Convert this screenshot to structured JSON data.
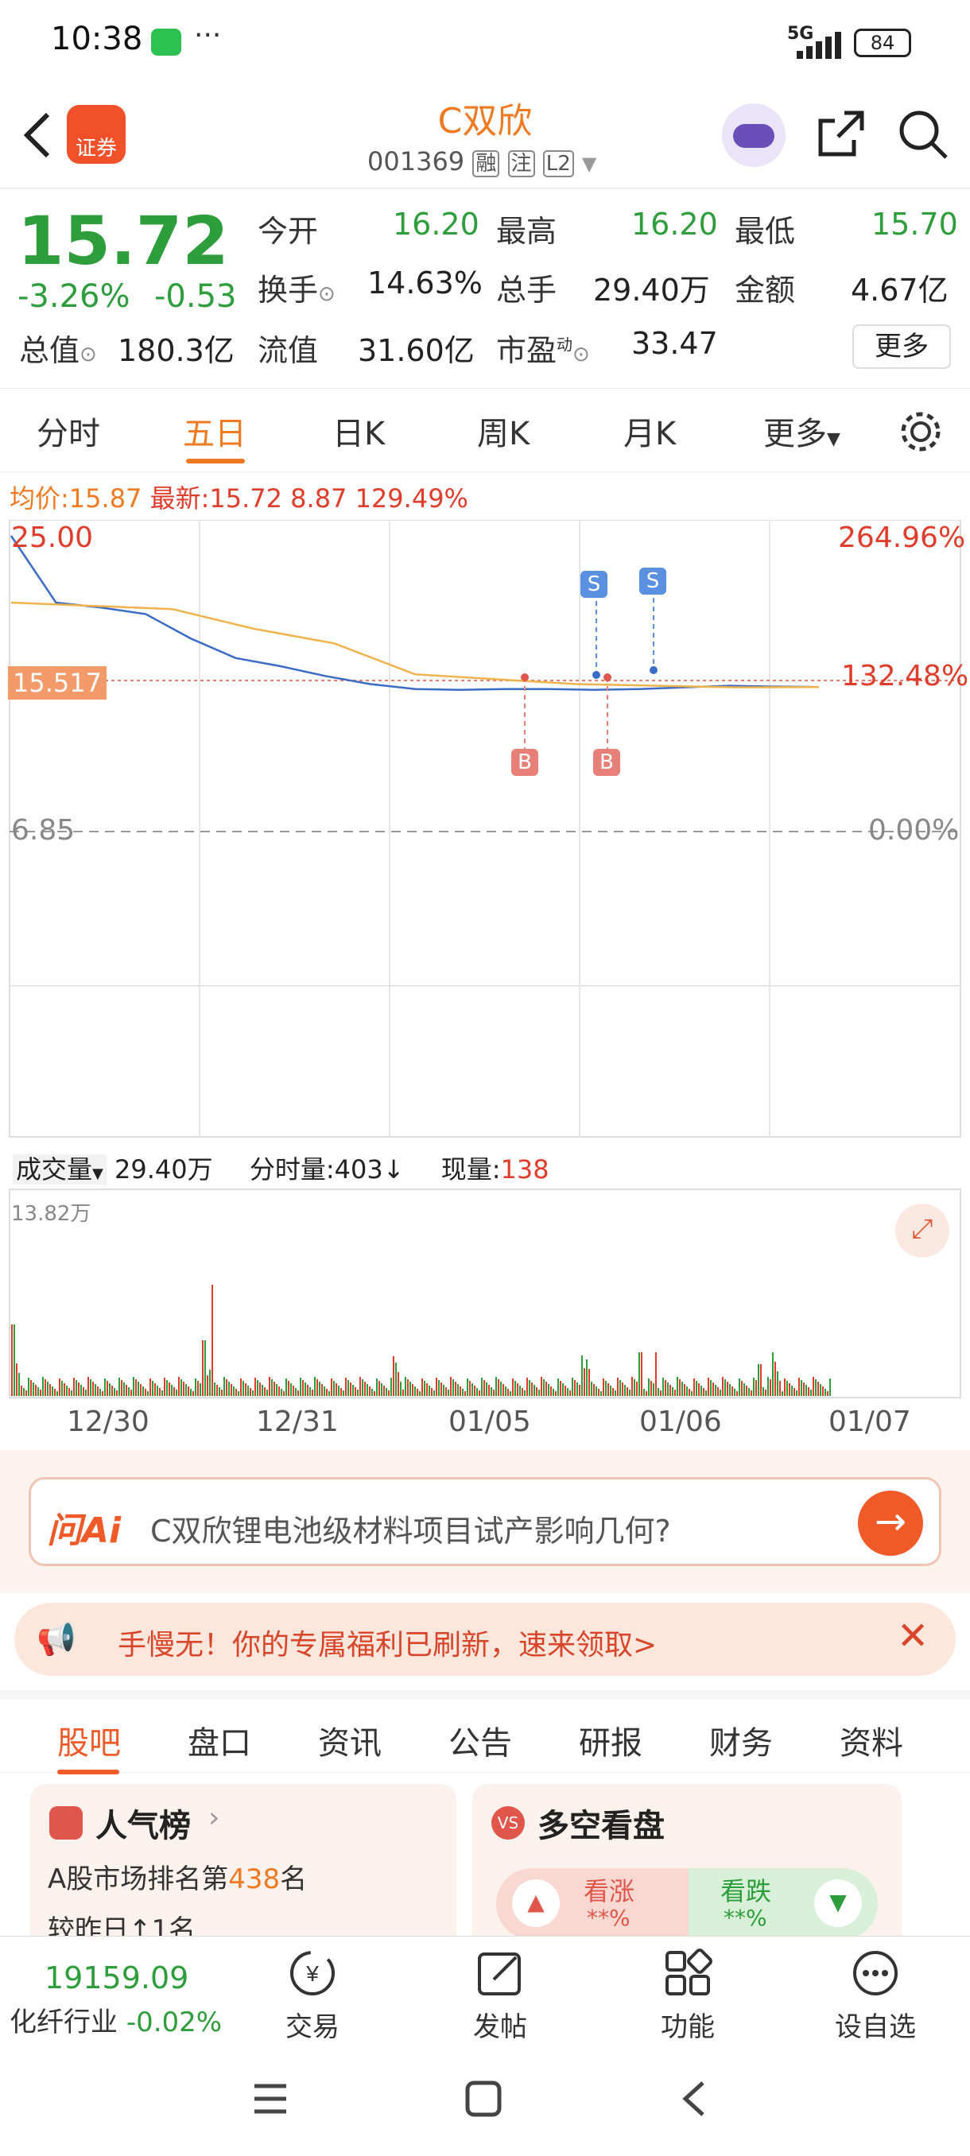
{
  "status_bar": {
    "time": "10:38",
    "network": "5G",
    "battery": "84"
  },
  "header": {
    "title": "C双欣",
    "code": "001369",
    "tags": [
      "融",
      "注",
      "L2"
    ],
    "logo_text": "证券"
  },
  "quote": {
    "price": "15.72",
    "change_pct": "-3.26%",
    "change": "-0.53",
    "open_label": "今开",
    "open": "16.20",
    "high_label": "最高",
    "high": "16.20",
    "low_label": "最低",
    "low": "15.70",
    "turnover_label": "换手",
    "turnover": "14.63%",
    "volume_label": "总手",
    "volume": "29.40万",
    "amount_label": "金额",
    "amount": "4.67亿",
    "mktcap_label": "总值",
    "mktcap": "180.3亿",
    "float_label": "流值",
    "float": "31.60亿",
    "pe_label": "市盈",
    "pe_sup": "动",
    "pe": "33.47",
    "more_button": "更多"
  },
  "tabs": [
    "分时",
    "五日",
    "日K",
    "周K",
    "月K",
    "更多"
  ],
  "active_tab": "五日",
  "chart": {
    "avg_label": "均价:",
    "avg_value": "15.87",
    "latest_label": "最新:",
    "latest_value": "15.72",
    "change_value": "8.87",
    "change_pct_value": "129.49%",
    "y_top": "25.00",
    "y_top_pct": "264.96%",
    "y_mid": "15.517",
    "y_mid_pct": "132.48%",
    "y_base": "6.85",
    "y_base_pct": "0.00%",
    "markers_sell": "S",
    "markers_buy": "B",
    "volume_selector": "成交量",
    "volume_total": "29.40万",
    "tick_volume_label": "分时量:",
    "tick_volume": "403",
    "tick_arrow": "↓",
    "cur_volume_label": "现量:",
    "cur_volume": "138",
    "volume_max": "13.82万",
    "dates": [
      "12/30",
      "12/31",
      "01/05",
      "01/06",
      "01/07"
    ]
  },
  "chart_data": {
    "type": "line",
    "title": "",
    "x": [
      "12/30",
      "12/31",
      "01/05",
      "01/06",
      "01/07"
    ],
    "series": [
      {
        "name": "",
        "values": [
          25.0,
          20.9,
          20.6,
          20.2,
          18.7,
          17.5,
          17.0,
          16.4,
          15.9,
          15.6,
          15.55,
          15.6,
          15.6,
          15.55,
          15.6,
          15.7,
          15.8,
          15.75,
          15.72
        ]
      },
      {
        "name": "",
        "values": [
          20.9,
          20.7,
          20.5,
          19.3,
          18.4,
          16.5,
          16.2,
          15.9,
          15.8,
          15.7,
          15.72
        ]
      }
    ],
    "ylim": [
      6.85,
      25.0
    ],
    "volume_ylim": [
      0,
      13.82
    ]
  },
  "ai": {
    "logo": "问Ai",
    "question": "C双欣锂电池级材料项目试产影响几何?"
  },
  "promo": {
    "text": "手慢无！你的专属福利已刷新，速来领取>"
  },
  "subtabs": [
    "股吧",
    "盘口",
    "资讯",
    "公告",
    "研报",
    "财务",
    "资料"
  ],
  "cards": {
    "popularity_title": "人气榜",
    "popularity_line1_prefix": "A股市场排名第",
    "popularity_rank": "438",
    "popularity_line1_suffix": "名",
    "popularity_line2": "较昨日↑1名",
    "sentiment_title": "多空看盘",
    "bull_label": "看涨",
    "bull_pct": "**%",
    "bear_label": "看跌",
    "bear_pct": "**%"
  },
  "bottom": {
    "index_value": "19159.09",
    "index_name": "化纤行业",
    "index_change": "-0.02%",
    "trade": "交易",
    "post": "发帖",
    "func": "功能",
    "watch": "设自选"
  }
}
